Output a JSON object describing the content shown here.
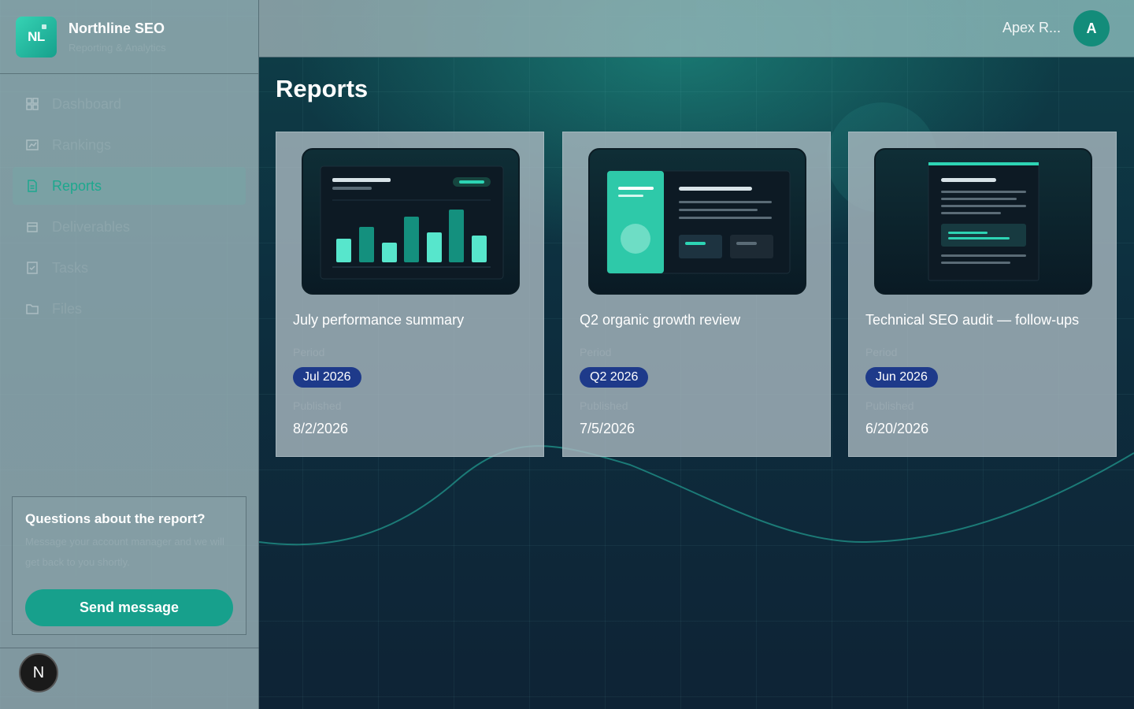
{
  "brand": {
    "logo_text": "NL",
    "name": "Northline SEO",
    "subtitle": "Reporting & Analytics"
  },
  "nav": [
    {
      "label": "Dashboard",
      "icon": "grid-icon",
      "active": false
    },
    {
      "label": "Rankings",
      "icon": "chart-icon",
      "active": false
    },
    {
      "label": "Reports",
      "icon": "document-icon",
      "active": true
    },
    {
      "label": "Deliverables",
      "icon": "package-icon",
      "active": false
    },
    {
      "label": "Tasks",
      "icon": "checklist-icon",
      "active": false
    },
    {
      "label": "Files",
      "icon": "folder-icon",
      "active": false
    }
  ],
  "help": {
    "title": "Questions about the report?",
    "body": "Message your account manager and we will get back to you shortly.",
    "button": "Send message"
  },
  "footer_badge": "N",
  "topbar": {
    "user_name": "Apex R...",
    "avatar_initial": "A"
  },
  "page": {
    "title": "Reports"
  },
  "reports": [
    {
      "title": "July performance summary",
      "period_label": "Period",
      "period": "Jul 2026",
      "published_label": "Published",
      "published": "8/2/2026"
    },
    {
      "title": "Q2 organic growth review",
      "period_label": "Period",
      "period": "Q2 2026",
      "published_label": "Published",
      "published": "7/5/2026"
    },
    {
      "title": "Technical SEO audit — follow-ups",
      "period_label": "Period",
      "period": "Jun 2026",
      "published_label": "Published",
      "published": "6/20/2026"
    }
  ],
  "colors": {
    "accent": "#17a08c",
    "pill": "#1e3a8a",
    "active_nav_text": "#1da88e"
  }
}
